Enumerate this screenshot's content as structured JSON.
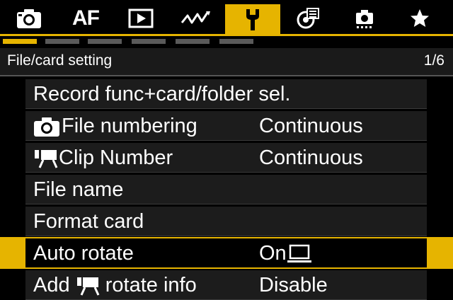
{
  "tabs": [
    {
      "name": "shooting",
      "icon": "camera-icon",
      "label": ""
    },
    {
      "name": "af",
      "icon": "af-text",
      "label": "AF"
    },
    {
      "name": "playback",
      "icon": "play-icon",
      "label": ""
    },
    {
      "name": "wireless",
      "icon": "wireless-icon",
      "label": ""
    },
    {
      "name": "setup",
      "icon": "wrench-icon",
      "label": "",
      "active": true
    },
    {
      "name": "custom-functions",
      "icon": "custom-functions-icon",
      "label": ""
    },
    {
      "name": "custom-mode",
      "icon": "custom-mode-icon",
      "label": ""
    },
    {
      "name": "my-menu",
      "icon": "star-icon",
      "label": ""
    }
  ],
  "page_indicators": {
    "count": 6,
    "active_index": 0
  },
  "section": {
    "title": "File/card setting",
    "page": "1/6"
  },
  "menu": {
    "items": [
      {
        "label": "Record func+card/folder sel.",
        "value": "",
        "icon": ""
      },
      {
        "label": "File numbering",
        "value": "Continuous",
        "icon": "camera-icon"
      },
      {
        "label": " Clip Number",
        "value": "Continuous",
        "icon": "movie-camera-icon"
      },
      {
        "label": "File name",
        "value": "",
        "icon": ""
      },
      {
        "label": "Format card",
        "value": "",
        "icon": ""
      },
      {
        "label": "Auto rotate",
        "value": "On",
        "icon": "",
        "value_icon": "computer-icon",
        "selected": true
      },
      {
        "label_prefix": "Add ",
        "label_suffix": " rotate info",
        "value": "Disable",
        "icon": "movie-camera-icon"
      }
    ]
  },
  "colors": {
    "accent": "#e6b400",
    "row_bg": "#1c1c1c",
    "inactive_indicator": "#5a5a5a"
  }
}
